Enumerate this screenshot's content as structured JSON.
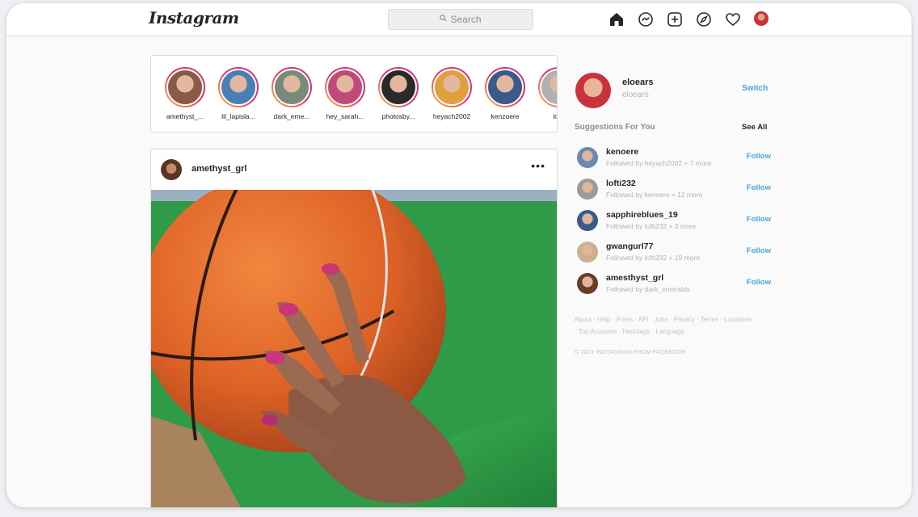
{
  "app": {
    "logo": "Instagram"
  },
  "search": {
    "placeholder": "Search",
    "icon": "search-icon"
  },
  "nav": {
    "icons": [
      "home-icon",
      "messenger-icon",
      "new-post-icon",
      "explore-icon",
      "heart-icon",
      "profile-avatar"
    ]
  },
  "stories": [
    {
      "name": "amethyst_...",
      "color": "#8a5a44"
    },
    {
      "name": "lil_lapisla...",
      "color": "#4a7fb5"
    },
    {
      "name": "dark_eme...",
      "color": "#7a8a7a"
    },
    {
      "name": "hey_sarah...",
      "color": "#c04a7a"
    },
    {
      "name": "photosby...",
      "color": "#2a2a2a"
    },
    {
      "name": "heyach2002",
      "color": "#e0a040"
    },
    {
      "name": "kenzoere",
      "color": "#3a5a8a"
    },
    {
      "name": "lofti",
      "color": "#b0b0b0"
    }
  ],
  "post": {
    "username": "amethyst_grl",
    "more_label": "•••",
    "image": "basketball-photo"
  },
  "profile": {
    "username": "eloears",
    "subname": "eloears",
    "switch_label": "Switch"
  },
  "suggestions": {
    "title": "Suggestions For You",
    "see_all": "See All",
    "items": [
      {
        "name": "kenoere",
        "sub": "Followed by heyach2002 + 7 more",
        "follow": "Follow",
        "color": "#6a8ab0"
      },
      {
        "name": "lofti232",
        "sub": "Followed by kenoere + 12 more",
        "follow": "Follow",
        "color": "#9a9a9a"
      },
      {
        "name": "sapphireblues_19",
        "sub": "Followed by lofti232 + 3 more",
        "follow": "Follow",
        "color": "#3a5a8a"
      },
      {
        "name": "gwangurl77",
        "sub": "Followed by lofti232 + 19 more",
        "follow": "Follow",
        "color": "#c8b090"
      },
      {
        "name": "amesthyst_grl",
        "sub": "Followed by dark_emeralds",
        "follow": "Follow",
        "color": "#6a3a2a"
      }
    ]
  },
  "footer": {
    "links": "About · Help · Press · API · Jobs · Privacy · Terms · Locations · Top Accounts · Hashtags · Language",
    "copyright": "© 2021 INSTAGRAM FROM FACEBOOK"
  }
}
